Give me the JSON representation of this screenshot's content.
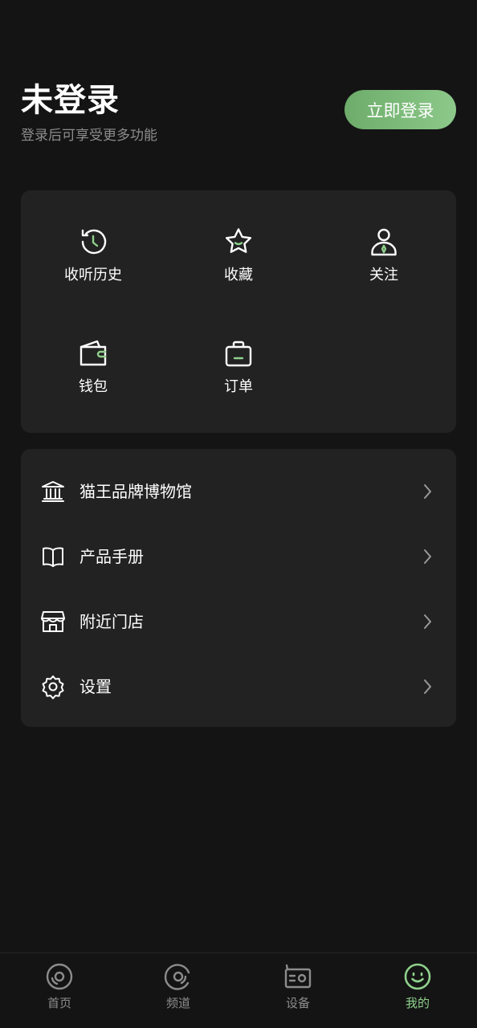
{
  "header": {
    "title": "未登录",
    "subtitle": "登录后可享受更多功能",
    "login_button": "立即登录"
  },
  "quick_actions": [
    {
      "label": "收听历史",
      "icon": "history-icon"
    },
    {
      "label": "收藏",
      "icon": "star-icon"
    },
    {
      "label": "关注",
      "icon": "follow-person-icon"
    },
    {
      "label": "钱包",
      "icon": "wallet-icon"
    },
    {
      "label": "订单",
      "icon": "order-bag-icon"
    }
  ],
  "menu": [
    {
      "label": "猫王品牌博物馆",
      "icon": "museum-icon"
    },
    {
      "label": "产品手册",
      "icon": "book-icon"
    },
    {
      "label": "附近门店",
      "icon": "store-icon"
    },
    {
      "label": "设置",
      "icon": "gear-icon"
    }
  ],
  "tabbar": [
    {
      "label": "首页",
      "icon": "vinyl-disc-icon",
      "active": false
    },
    {
      "label": "频道",
      "icon": "channel-disc-icon",
      "active": false
    },
    {
      "label": "设备",
      "icon": "radio-device-icon",
      "active": false
    },
    {
      "label": "我的",
      "icon": "smile-face-icon",
      "active": true
    }
  ],
  "colors": {
    "background": "#141414",
    "card": "#222222",
    "accent": "#8fd18c",
    "button_gradient_start": "#6dac6a",
    "button_gradient_end": "#8cc98a",
    "muted_text": "#8c8c8c"
  }
}
